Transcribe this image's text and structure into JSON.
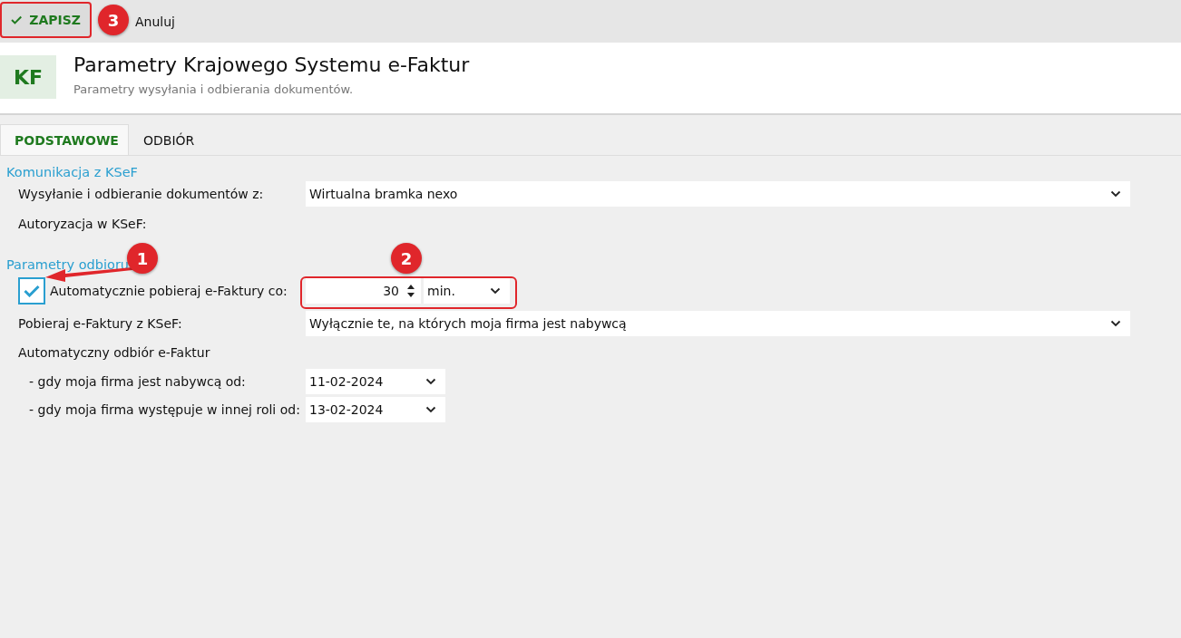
{
  "toolbar": {
    "save_button": {
      "label": "ZAPISZ"
    },
    "cancel_button": {
      "label": "Anuluj"
    }
  },
  "header": {
    "logo": "KF",
    "title": "Parametry Krajowego Systemu e-Faktur",
    "subtitle": "Parametry wysyłania i odbierania dokumentów."
  },
  "tabs": [
    {
      "label": "PODSTAWOWE",
      "selected": true
    },
    {
      "label": "ODBIÓR",
      "selected": false
    }
  ],
  "sections": [
    {
      "title": "Komunikacja z KSeF",
      "rows": [
        {
          "kind": "select",
          "label": "Wysyłanie i odbieranie dokumentów z:",
          "value": "Wirtualna bramka nexo"
        },
        {
          "kind": "label",
          "label": "Autoryzacja w KSeF:"
        }
      ]
    },
    {
      "title": "Parametry odbioru",
      "rows": [
        {
          "kind": "interval",
          "label": "Automatycznie pobieraj e-Faktury co:",
          "checked": true,
          "value": "30",
          "unit": "min."
        },
        {
          "kind": "select",
          "label": "Pobieraj e-Faktury z KSeF:",
          "value": "Wyłącznie te, na których moja firma jest nabywcą"
        },
        {
          "kind": "label",
          "label": "Automatyczny odbiór e-Faktur"
        },
        {
          "kind": "date",
          "label": "- gdy moja firma jest nabywcą od:",
          "value": "11-02-2024"
        },
        {
          "kind": "date",
          "label": "- gdy moja firma występuje w innej roli od:",
          "value": "13-02-2024"
        }
      ]
    }
  ],
  "annotations": [
    {
      "number": "1"
    },
    {
      "number": "2"
    },
    {
      "number": "3"
    }
  ]
}
